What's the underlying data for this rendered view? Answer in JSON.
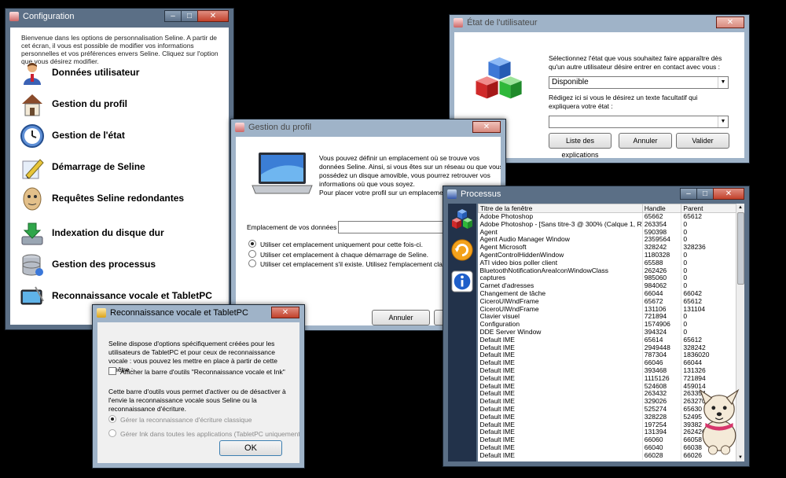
{
  "config": {
    "title": "Configuration",
    "intro": "Bienvenue dans les options de personnalisation Seline. A partir de cet écran, il vous est possible de modifier vos informations personnelles et vos préférences envers Seline. Cliquez sur l'option que vous désirez modifier.",
    "items": [
      {
        "label": "Données utilisateur",
        "icon": "user-icon"
      },
      {
        "label": "Gestion du profil",
        "icon": "house-icon"
      },
      {
        "label": "Gestion de l'état",
        "icon": "clock-icon"
      },
      {
        "label": "Démarrage de Seline",
        "icon": "pencil-icon"
      },
      {
        "label": "Requêtes Seline redondantes",
        "icon": "face-icon"
      },
      {
        "label": "Indexation du disque dur",
        "icon": "download-disk-icon"
      },
      {
        "label": "Gestion des processus",
        "icon": "database-icon"
      },
      {
        "label": "Reconnaissance vocale et TabletPC",
        "icon": "tablet-icon"
      }
    ]
  },
  "etat": {
    "title": "État de l'utilisateur",
    "prompt": "Sélectionnez l'état que vous souhaitez faire apparaître dès qu'un autre utilisateur désire entrer en contact avec vous :",
    "state_value": "Disponible",
    "explain_prompt": "Rédigez ici si vous le désirez un texte facultatif qui expliquera votre état :",
    "explain_value": "",
    "btn_list": "Liste des explications",
    "btn_cancel": "Annuler",
    "btn_ok": "Valider"
  },
  "profil": {
    "title": "Gestion du profil",
    "text1": "Vous pouvez définir un emplacement où se trouve vos données Seline. Ainsi, si vous êtes sur un réseau ou que vous possédez un disque amovible, vous pourrez retrouver vos informations où que vous soyez.",
    "text2": "Pour placer votre profil sur un emplacement ext",
    "location_label": "Emplacement de vos données :",
    "location_value": "",
    "options": [
      "Utiliser cet emplacement uniquement pour cette fois-ci.",
      "Utiliser cet emplacement à chaque démarrage de Seline.",
      "Utiliser cet emplacement s'il existe. Utilisez l'emplacement classique dan"
    ],
    "btn_cancel": "Annuler"
  },
  "vocal": {
    "title": "Reconnaissance vocale et TabletPC",
    "text1": "Seline dispose d'options spécifiquement créées pour les utilisateurs de TabletPC et pour ceux de reconnaissance vocale : vous pouvez les mettre en place à partir de cette fenêtre :",
    "checkbox": "Afficher la barre d'outils \"Reconnaissance vocale et Ink\"",
    "text2": "Cette barre d'outils vous permet d'activer ou de désactiver à l'envie la reconnaissance vocale sous Seline ou la reconnaissance d'écriture.",
    "radio1": "Gérer la reconnaissance d'écriture classique",
    "radio2": "Gérer Ink dans toutes les applications (TabletPC uniquement)",
    "btn_ok": "OK"
  },
  "processus": {
    "title": "Processus",
    "columns": [
      "Titre de la fenêtre",
      "Handle",
      "Parent"
    ],
    "rows": [
      [
        "Adobe Photoshop",
        "65662",
        "65612"
      ],
      [
        "Adobe Photoshop - [Sans titre-3 @ 300% (Calque 1, RVB)]",
        "263354",
        "0"
      ],
      [
        "Agent",
        "590398",
        "0"
      ],
      [
        "Agent Audio Manager Window",
        "2359564",
        "0"
      ],
      [
        "Agent Microsoft",
        "328242",
        "328236"
      ],
      [
        "AgentControlHiddenWindow",
        "1180328",
        "0"
      ],
      [
        "ATI video bios poller client",
        "65588",
        "0"
      ],
      [
        "BluetoothNotificationAreaIconWindowClass",
        "262426",
        "0"
      ],
      [
        "captures",
        "985060",
        "0"
      ],
      [
        "Carnet d'adresses",
        "984062",
        "0"
      ],
      [
        "Changement de tâche",
        "66044",
        "66042"
      ],
      [
        "CiceroUIWndFrame",
        "65672",
        "65612"
      ],
      [
        "CiceroUIWndFrame",
        "131106",
        "131104"
      ],
      [
        "Clavier visuel",
        "721894",
        "0"
      ],
      [
        "Configuration",
        "1574906",
        "0"
      ],
      [
        "DDE Server Window",
        "394324",
        "0"
      ],
      [
        "Default IME",
        "65614",
        "65612"
      ],
      [
        "Default IME",
        "2949448",
        "328242"
      ],
      [
        "Default IME",
        "787304",
        "1836020"
      ],
      [
        "Default IME",
        "66046",
        "66044"
      ],
      [
        "Default IME",
        "393468",
        "131326"
      ],
      [
        "Default IME",
        "1115126",
        "721894"
      ],
      [
        "Default IME",
        "524608",
        "459014"
      ],
      [
        "Default IME",
        "263432",
        "263354"
      ],
      [
        "Default IME",
        "329026",
        "263270"
      ],
      [
        "Default IME",
        "525274",
        "65630"
      ],
      [
        "Default IME",
        "328228",
        "52495"
      ],
      [
        "Default IME",
        "197254",
        "39382"
      ],
      [
        "Default IME",
        "131394",
        "262426"
      ],
      [
        "Default IME",
        "66060",
        "66058"
      ],
      [
        "Default IME",
        "66040",
        "66038"
      ],
      [
        "Default IME",
        "66028",
        "66026"
      ]
    ]
  }
}
